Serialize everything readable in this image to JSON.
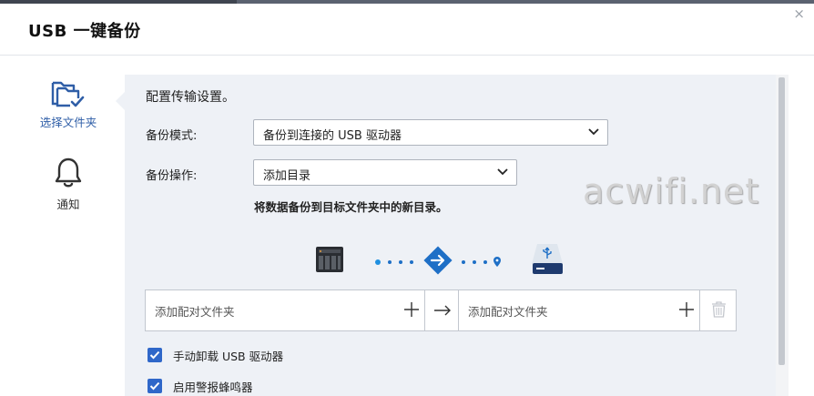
{
  "dialog": {
    "title": "USB 一键备份",
    "close_label": "×"
  },
  "sidebar": {
    "items": [
      {
        "label": "选择文件夹",
        "icon": "folder-check-icon",
        "active": true
      },
      {
        "label": "通知",
        "icon": "bell-icon",
        "active": false
      }
    ]
  },
  "main": {
    "heading": "配置传输设置。",
    "backup_mode": {
      "label": "备份模式:",
      "value": "备份到连接的 USB 驱动器"
    },
    "backup_operation": {
      "label": "备份操作:",
      "value": "添加目录"
    },
    "hint": "将数据备份到目标文件夹中的新目录。",
    "flow": {
      "source_icon": "nas-device-icon",
      "direction_icon": "arrow-diamond-icon",
      "target_icon": "usb-drive-icon"
    },
    "folder_pair": {
      "source_placeholder": "添加配对文件夹",
      "target_placeholder": "添加配对文件夹",
      "arrow": "→"
    },
    "options": [
      {
        "label": "手动卸载 USB 驱动器",
        "checked": true
      },
      {
        "label": "启用警报蜂鸣器",
        "checked": true
      }
    ]
  },
  "colors": {
    "accent": "#2f67c9",
    "active_nav": "#2f5ea7",
    "panel_bg": "#eef1f6"
  },
  "watermark": "acwifi.net"
}
